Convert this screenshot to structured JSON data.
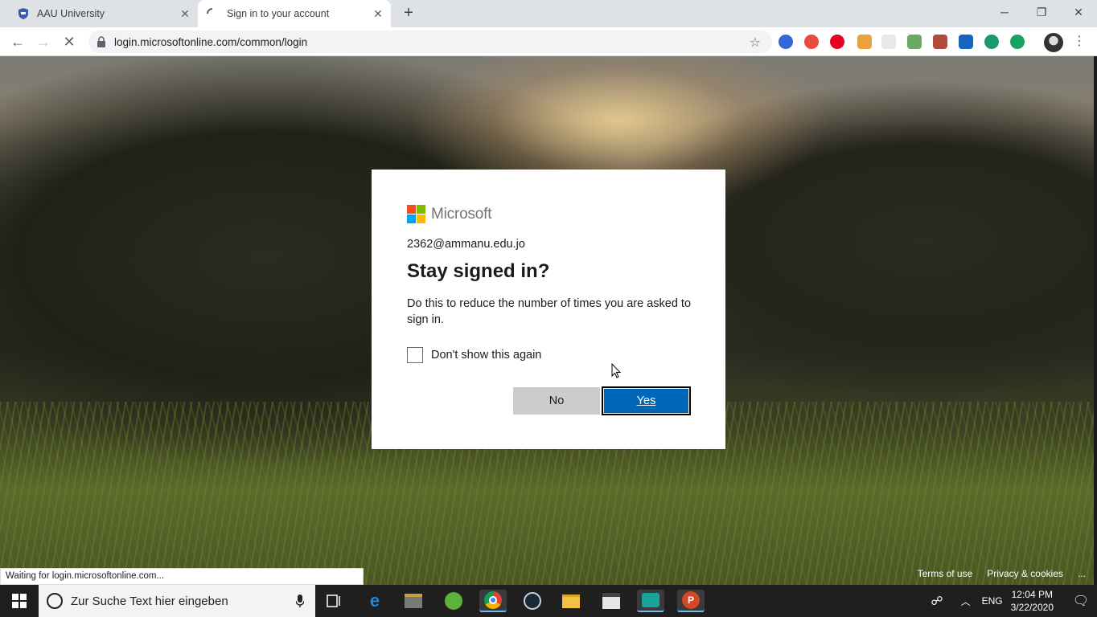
{
  "browser": {
    "tabs": [
      {
        "label": "AAU University"
      },
      {
        "label": "Sign in to your account"
      }
    ],
    "url": "login.microsoftonline.com/common/login",
    "status_text": "Waiting for login.microsoftonline.com..."
  },
  "dialog": {
    "brand": "Microsoft",
    "account": "2362@ammanu.edu.jo",
    "heading": "Stay signed in?",
    "description": "Do this to reduce the number of times you are asked to sign in.",
    "checkbox_label": "Don't show this again",
    "checkbox_checked": false,
    "no_label": "No",
    "yes_label": "Yes"
  },
  "footer": {
    "terms": "Terms of use",
    "privacy": "Privacy & cookies",
    "more": "..."
  },
  "taskbar": {
    "search_placeholder": "Zur Suche Text hier eingeben",
    "language": "ENG",
    "time": "12:04 PM",
    "date": "3/22/2020",
    "icons": [
      "task-view-icon",
      "edge-icon",
      "media-player-icon",
      "utorrent-icon",
      "chrome-icon",
      "steam-icon",
      "file-explorer-icon",
      "calendar-app-icon",
      "game-app-icon",
      "powerpoint-icon"
    ]
  },
  "colors": {
    "accent": "#0067b8",
    "ms_red": "#f25022",
    "ms_green": "#7fba00",
    "ms_blue": "#00a4ef",
    "ms_yellow": "#ffb900"
  }
}
